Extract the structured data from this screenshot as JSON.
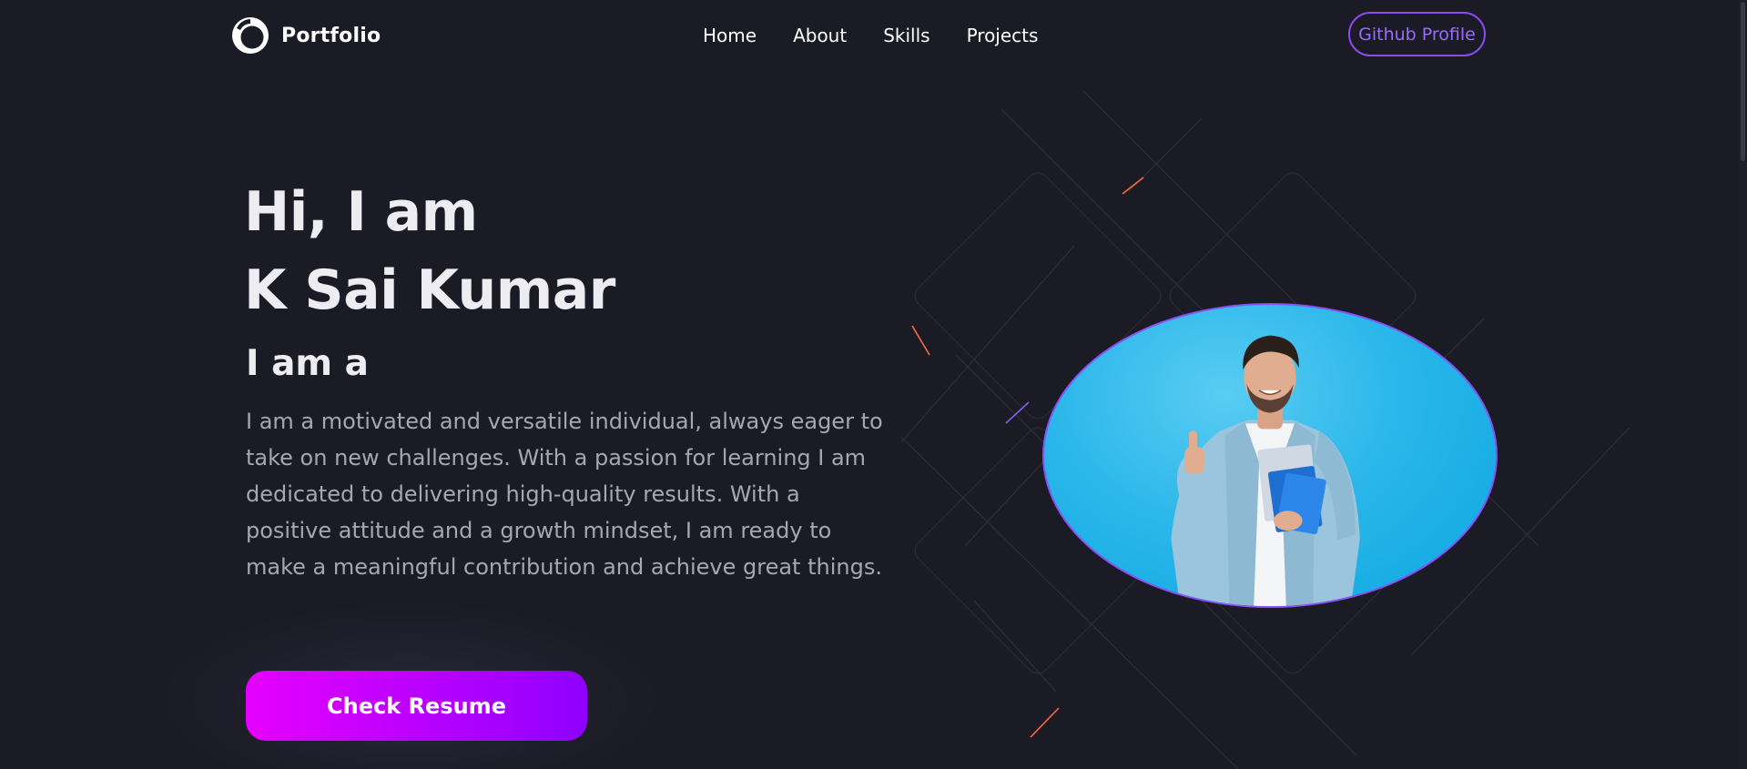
{
  "nav": {
    "brand": "Portfolio",
    "links": [
      "Home",
      "About",
      "Skills",
      "Projects"
    ],
    "cta": "Github Profile"
  },
  "hero": {
    "greeting": "Hi, I am",
    "name": "K Sai Kumar",
    "typing_prefix": "I am a",
    "bio": "I am a motivated and versatile individual, always eager to take on new challenges. With a passion for learning I am dedicated to delivering high-quality results. With a positive attitude and a growth mindset, I am ready to make a meaningful contribution and achieve great things.",
    "resume_button": "Check Resume",
    "portrait_alt": "profile-photo"
  },
  "colors": {
    "background": "#1b1b25",
    "accent_purple": "#8b4cf4",
    "button_gradient_start": "#e600ff",
    "button_gradient_end": "#8f00ff",
    "portrait_background": "#0aa6e0"
  },
  "icons": {
    "brand": "portfolio-logo-icon"
  }
}
